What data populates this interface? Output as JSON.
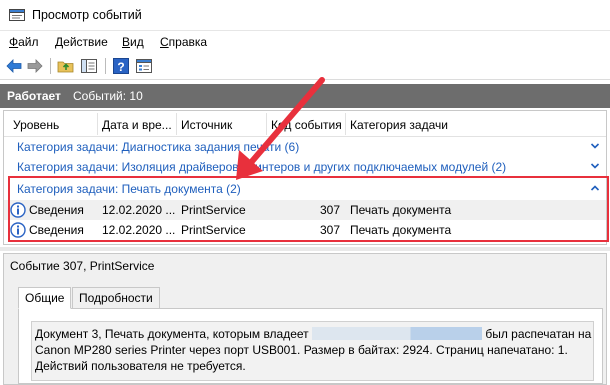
{
  "window": {
    "title": "Просмотр событий"
  },
  "menu": {
    "items": [
      {
        "pre": "",
        "u": "Ф",
        "post": "айл"
      },
      {
        "pre": "",
        "u": "Д",
        "post": "ействие"
      },
      {
        "pre": "",
        "u": "В",
        "post": "ид"
      },
      {
        "pre": "",
        "u": "С",
        "post": "правка"
      }
    ]
  },
  "toolbar": {
    "icons": [
      "back-icon",
      "forward-icon",
      "up-folder-icon",
      "show-hide-tree-icon",
      "help-icon",
      "properties-icon"
    ]
  },
  "status": {
    "state": "Работает",
    "count": "Событий: 10"
  },
  "columns": [
    "Уровень",
    "Дата и вре...",
    "Источник",
    "Код события",
    "Категория задачи"
  ],
  "groups": [
    {
      "label": "Категория задачи: Диагностика задания печати (6)",
      "chevron": "expand"
    },
    {
      "label": "Категория задачи: Изоляция драйверов принтеров и других подключаемых модулей (2)",
      "chevron": "expand"
    },
    {
      "label": "Категория задачи: Печать документа (2)",
      "chevron": "collapse"
    }
  ],
  "rows": [
    {
      "level": "Сведения",
      "date": "12.02.2020 ...",
      "source": "PrintService",
      "code": "307",
      "category": "Печать документа"
    },
    {
      "level": "Сведения",
      "date": "12.02.2020 ...",
      "source": "PrintService",
      "code": "307",
      "category": "Печать документа"
    }
  ],
  "details": {
    "title": "Событие 307, PrintService",
    "tabs": [
      "Общие",
      "Подробности"
    ],
    "text_part1": "Документ 3, Печать документа, которым владеет ",
    "text_part2": " был распечатан на Canon MP280 series Printer через порт USB001.  Размер в байтах: 2924. Страниц напечатано: 1. Действий пользователя не требуется."
  },
  "colors": {
    "group_link": "#1f5fbd",
    "highlight": "#e8303c",
    "status_bg": "#6d6d6d"
  }
}
